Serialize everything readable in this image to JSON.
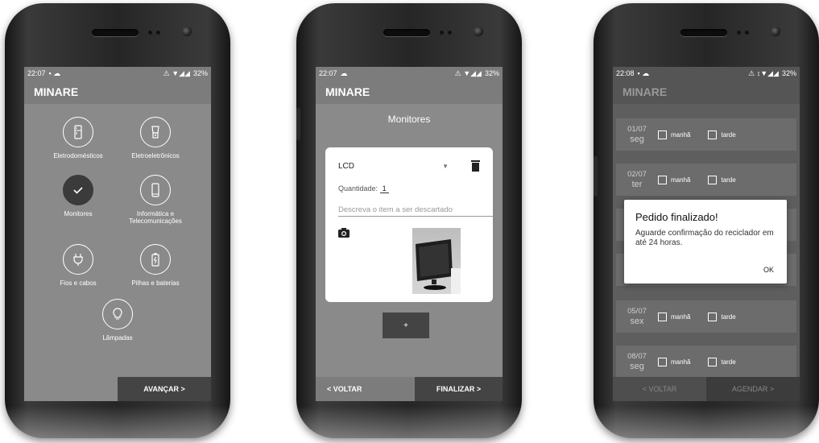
{
  "phone1": {
    "status": {
      "time": "22:07",
      "battery": "32%"
    },
    "app_title": "MINARE",
    "categories": [
      {
        "label": "Eletrodomésticos",
        "icon": "fridge-icon",
        "selected": false
      },
      {
        "label": "Eletroeletrônicos",
        "icon": "blender-icon",
        "selected": false
      },
      {
        "label": "Monitores",
        "icon": "check-icon",
        "selected": true
      },
      {
        "label": "Informática e Telecomunicações",
        "icon": "phone-icon",
        "selected": false
      },
      {
        "label": "Fios e cabos",
        "icon": "plug-icon",
        "selected": false
      },
      {
        "label": "Pilhas e baterias",
        "icon": "battery-icon",
        "selected": false
      },
      {
        "label": "Lâmpadas",
        "icon": "lightbulb-icon",
        "selected": false
      }
    ],
    "next_button": "AVANÇAR >"
  },
  "phone2": {
    "status": {
      "time": "22:07",
      "battery": "32%"
    },
    "app_title": "MINARE",
    "page_title": "Monitores",
    "item": {
      "type_value": "LCD",
      "quantity_label": "Quantidade:",
      "quantity_value": "1",
      "description_placeholder": "Descreva o item a ser descartado"
    },
    "add_button": "+",
    "back_button": "< VOLTAR",
    "finish_button": "FINALIZAR >"
  },
  "phone3": {
    "status": {
      "time": "22:08",
      "battery": "32%"
    },
    "app_title": "MINARE",
    "days": [
      {
        "date": "01/07",
        "weekday": "seg"
      },
      {
        "date": "02/07",
        "weekday": "ter"
      },
      {
        "date": "",
        "weekday": ""
      },
      {
        "date": "",
        "weekday": ""
      },
      {
        "date": "05/07",
        "weekday": "sex"
      },
      {
        "date": "08/07",
        "weekday": "seg"
      }
    ],
    "morning_label": "manhã",
    "afternoon_label": "tarde",
    "dialog": {
      "title": "Pedido finalizado!",
      "message": "Aguarde confirmação do reciclador em até 24 horas.",
      "ok": "OK"
    },
    "back_button": "< VOLTAR",
    "schedule_button": "AGENDAR >"
  }
}
